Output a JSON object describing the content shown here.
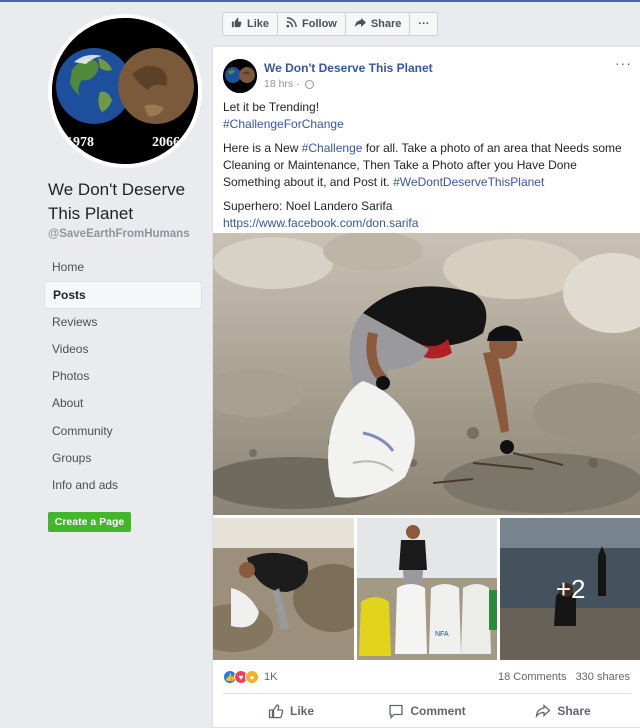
{
  "sidebar": {
    "profile_years": [
      "1978",
      "2066"
    ],
    "page_name": "We Don't Deserve This Planet",
    "page_handle": "@SaveEarthFromHumans",
    "nav": [
      {
        "label": "Home",
        "active": false
      },
      {
        "label": "Posts",
        "active": true
      },
      {
        "label": "Reviews",
        "active": false
      },
      {
        "label": "Videos",
        "active": false
      },
      {
        "label": "Photos",
        "active": false
      },
      {
        "label": "About",
        "active": false
      },
      {
        "label": "Community",
        "active": false
      },
      {
        "label": "Groups",
        "active": false
      },
      {
        "label": "Info and ads",
        "active": false
      }
    ],
    "create_page_label": "Create a Page"
  },
  "actionbar": {
    "like_label": "Like",
    "follow_label": "Follow",
    "share_label": "Share",
    "more_label": "···"
  },
  "post": {
    "author": "We Don't Deserve This Planet",
    "time": "18 hrs ·",
    "more_label": "···",
    "line1": "Let it be Trending!",
    "hashtag1": "#ChallengeForChange",
    "para2_a": "Here is a New ",
    "para2_tag": "#Challenge",
    "para2_b": " for all. Take a photo of an area that Needs some Cleaning or Maintenance, Then Take a Photo after you Have Done Something about it, and Post it. ",
    "para2_tag2": "#WeDontDeserveThisPlanet",
    "superhero": "Superhero: Noel Landero Sarifa",
    "url": "https://www.facebook.com/don.sarifa",
    "extra_photos": "+2",
    "reaction_count": "1K",
    "comments": "18 Comments",
    "shares": "330 shares",
    "like_label": "Like",
    "comment_label": "Comment",
    "share_label": "Share"
  },
  "colors": {
    "brand": "#4267b2",
    "link": "#365899",
    "green": "#42b72a",
    "background": "#e9ebee"
  }
}
